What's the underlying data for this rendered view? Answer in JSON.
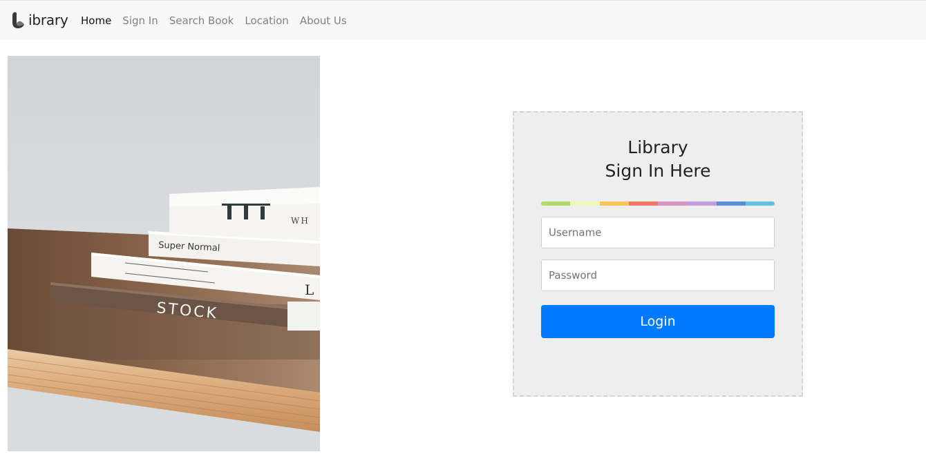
{
  "navbar": {
    "brand_text": "ibrary",
    "brand_logo_icon": "stylized-L-logo-icon",
    "links": [
      {
        "label": "Home",
        "active": true
      },
      {
        "label": "Sign In",
        "active": false
      },
      {
        "label": "Search Book",
        "active": false
      },
      {
        "label": "Location",
        "active": false
      },
      {
        "label": "About Us",
        "active": false
      }
    ]
  },
  "photo": {
    "books": [
      {
        "spine": "Super Normal"
      },
      {
        "spine": "STOCK"
      }
    ]
  },
  "login": {
    "title_line1": "Library",
    "title_line2": "Sign In Here",
    "color_bar": [
      "#b5d86a",
      "#f0f5b8",
      "#f9c45c",
      "#ef7667",
      "#d794bc",
      "#c29ddd",
      "#5b8ed8",
      "#62c0e4"
    ],
    "username_placeholder": "Username",
    "password_placeholder": "Password",
    "submit_label": "Login",
    "submit_color": "#007bff"
  }
}
